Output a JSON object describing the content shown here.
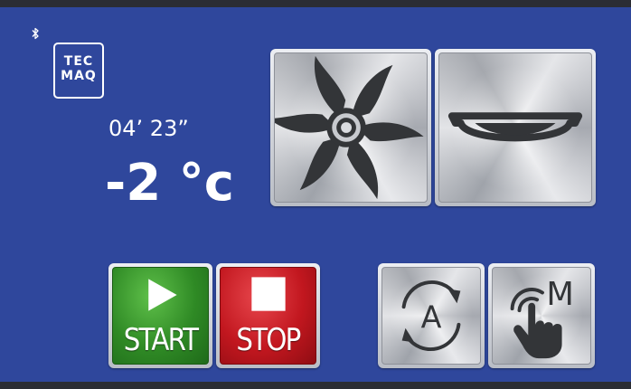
{
  "brand": {
    "line1": "TEC",
    "line2": "MAQ"
  },
  "status": {
    "timer": "04’ 23”",
    "temperature": "-2 °c"
  },
  "icons": {
    "bluetooth": "bluetooth-icon",
    "fan": "fan-icon",
    "tray": "tray-icon",
    "auto": "auto-cycle-icon",
    "manual": "manual-touch-icon",
    "play": "play-icon",
    "stop": "stop-square-icon"
  },
  "controls": {
    "start_label": "START",
    "stop_label": "STOP",
    "auto_letter": "A",
    "manual_letter": "M"
  },
  "colors": {
    "panel": "#2f479c",
    "start": "#2f8a25",
    "stop": "#c2171f",
    "icon_dark": "#333538"
  }
}
